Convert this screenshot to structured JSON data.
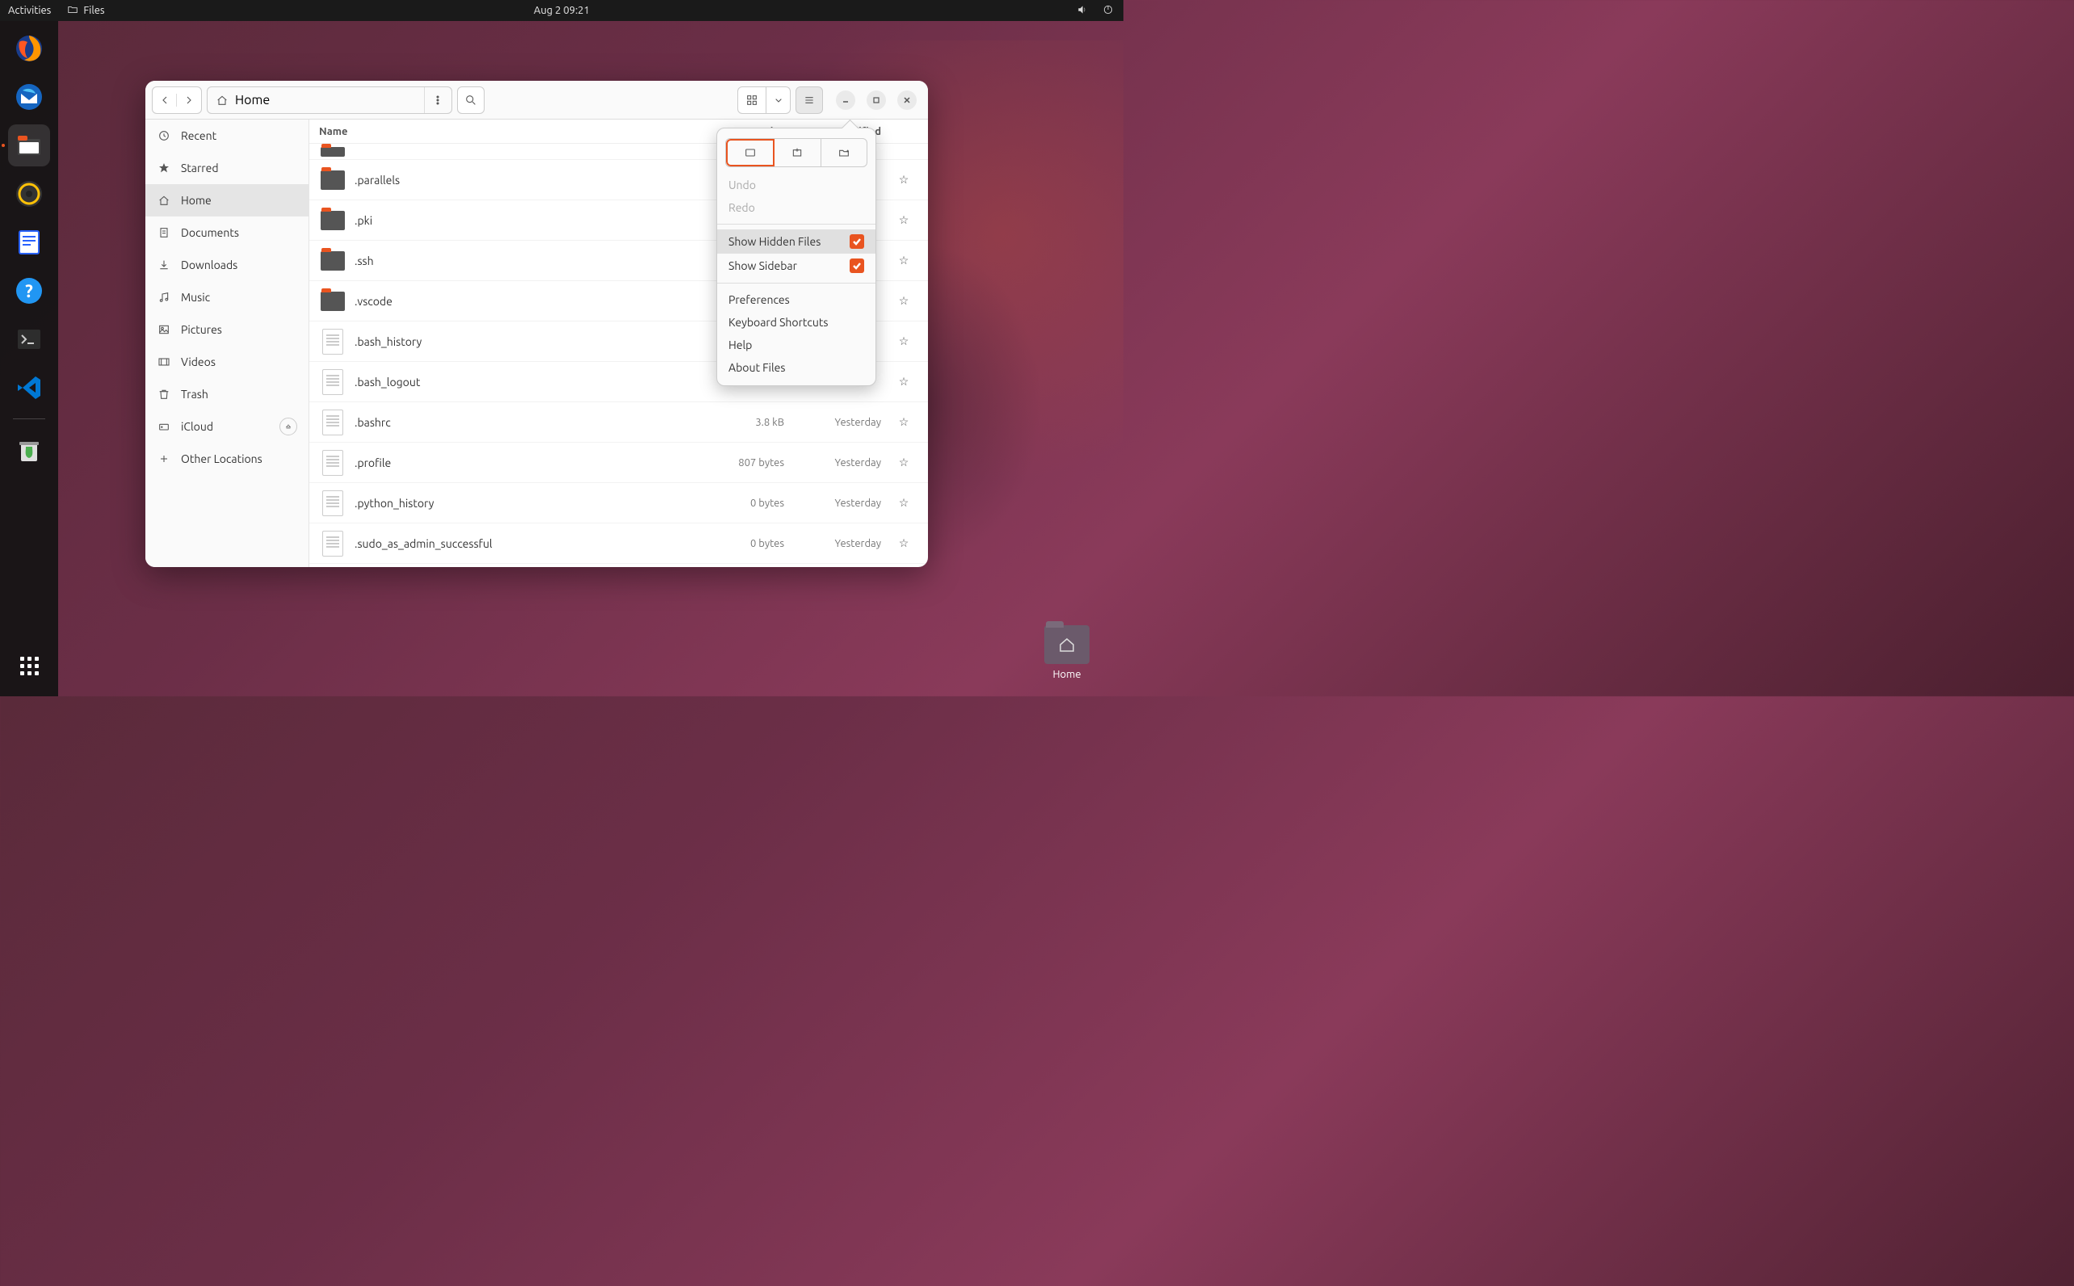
{
  "topbar": {
    "activities": "Activities",
    "app_name": "Files",
    "datetime": "Aug 2  09:21"
  },
  "dock": {
    "items": [
      "firefox",
      "thunderbird",
      "files",
      "rhythmbox",
      "libreoffice-writer",
      "help",
      "terminal",
      "vscode",
      "trash"
    ],
    "active_index": 2
  },
  "desktop": {
    "home_label": "Home"
  },
  "window": {
    "path_label": "Home",
    "columns": {
      "name": "Name",
      "size": "Size",
      "modified": "Modified"
    },
    "sidebar": [
      {
        "icon": "recent",
        "label": "Recent"
      },
      {
        "icon": "star",
        "label": "Starred"
      },
      {
        "icon": "home",
        "label": "Home",
        "selected": true
      },
      {
        "icon": "documents",
        "label": "Documents"
      },
      {
        "icon": "downloads",
        "label": "Downloads"
      },
      {
        "icon": "music",
        "label": "Music"
      },
      {
        "icon": "pictures",
        "label": "Pictures"
      },
      {
        "icon": "videos",
        "label": "Videos"
      },
      {
        "icon": "trash",
        "label": "Trash"
      },
      {
        "icon": "drive",
        "label": "iCloud",
        "eject": true
      },
      {
        "icon": "other",
        "label": "Other Locations"
      }
    ],
    "files": [
      {
        "type": "folder",
        "name": ".parallels",
        "size": "",
        "modified": ""
      },
      {
        "type": "folder",
        "name": ".pki",
        "size": "",
        "modified": ""
      },
      {
        "type": "folder",
        "name": ".ssh",
        "size": "",
        "modified": ""
      },
      {
        "type": "folder",
        "name": ".vscode",
        "size": "",
        "modified": ""
      },
      {
        "type": "file",
        "name": ".bash_history",
        "size": "",
        "modified": ""
      },
      {
        "type": "file",
        "name": ".bash_logout",
        "size": "",
        "modified": ""
      },
      {
        "type": "file",
        "name": ".bashrc",
        "size": "3.8 kB",
        "modified": "Yesterday"
      },
      {
        "type": "file",
        "name": ".profile",
        "size": "807 bytes",
        "modified": "Yesterday"
      },
      {
        "type": "file",
        "name": ".python_history",
        "size": "0 bytes",
        "modified": "Yesterday"
      },
      {
        "type": "file",
        "name": ".sudo_as_admin_successful",
        "size": "0 bytes",
        "modified": "Yesterday"
      }
    ]
  },
  "menu": {
    "undo": "Undo",
    "redo": "Redo",
    "show_hidden": "Show Hidden Files",
    "show_sidebar": "Show Sidebar",
    "preferences": "Preferences",
    "shortcuts": "Keyboard Shortcuts",
    "help": "Help",
    "about": "About Files",
    "show_hidden_checked": true,
    "show_sidebar_checked": true
  }
}
